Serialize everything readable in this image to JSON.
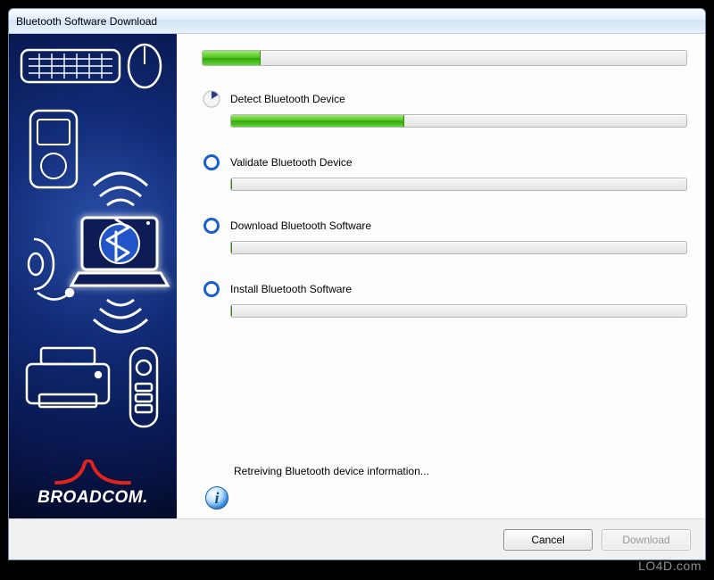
{
  "window": {
    "title": "Bluetooth Software Download"
  },
  "overall_progress_percent": 12,
  "steps": [
    {
      "label": "Detect Bluetooth Device",
      "state": "active",
      "progress_percent": 38
    },
    {
      "label": "Validate Bluetooth Device",
      "state": "pending",
      "progress_percent": 0
    },
    {
      "label": "Download Bluetooth Software",
      "state": "pending",
      "progress_percent": 0
    },
    {
      "label": "Install Bluetooth Software",
      "state": "pending",
      "progress_percent": 0
    }
  ],
  "status_message": "Retreiving Bluetooth device information...",
  "buttons": {
    "cancel": {
      "label": "Cancel",
      "enabled": true
    },
    "download": {
      "label": "Download",
      "enabled": false
    }
  },
  "brand": "BROADCOM.",
  "watermark": "LO4D.com",
  "colors": {
    "accent": "#1a5fd0",
    "progress_green": "#4fc51e",
    "sidebar_bg": "#0d1f66"
  }
}
